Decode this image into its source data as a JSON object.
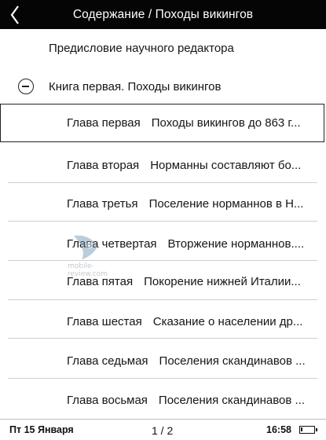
{
  "header": {
    "title": "Содержание / Походы викингов",
    "back_icon": "chevron-left-icon"
  },
  "toc": {
    "preface": "Предисловие научного редактора",
    "book": "Книга первая. Походы викингов",
    "collapse_icon": "collapse-minus-icon",
    "chapters": [
      {
        "num": "Глава первая",
        "title": "Походы викингов до 863 г..."
      },
      {
        "num": "Глава вторая",
        "title": "Норманны составляют бо..."
      },
      {
        "num": "Глава третья",
        "title": "Поселение норманнов в Н..."
      },
      {
        "num": "Глава четвертая",
        "title": "Вторжение норманнов...."
      },
      {
        "num": "Глава пятая",
        "title": "Покорение нижней Италии..."
      },
      {
        "num": "Глава шестая",
        "title": "Сказание о населении др..."
      },
      {
        "num": "Глава седьмая",
        "title": "Поселения скандинавов ..."
      },
      {
        "num": "Глава восьмая",
        "title": "Поселения скандинавов ..."
      }
    ],
    "selected_index": 0
  },
  "footer": {
    "date": "Пт 15 Января",
    "page": "1 / 2",
    "time": "16:58",
    "battery_level": 0.15
  },
  "watermark": {
    "text": "mobile-review.com"
  }
}
